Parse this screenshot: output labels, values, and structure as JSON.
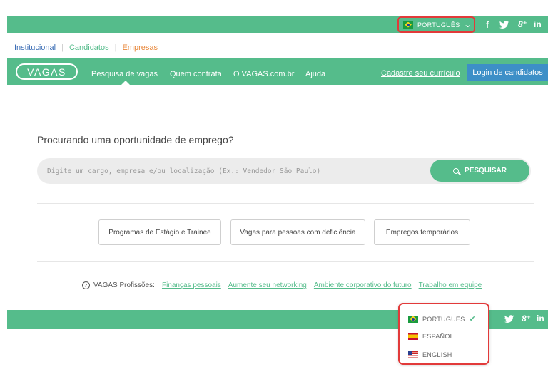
{
  "top_bar": {
    "language_selected": "PORTUGUÊS",
    "chevron": "chevron-down-icon",
    "social": {
      "facebook": "f",
      "twitter": "twitter-bird-icon",
      "google_plus": "8⁺",
      "linkedin": "in"
    }
  },
  "sub_nav": {
    "items": [
      {
        "label": "Institucional"
      },
      {
        "label": "Candidatos"
      },
      {
        "label": "Empresas"
      }
    ]
  },
  "main_nav": {
    "logo": "VAGAS",
    "links": [
      {
        "label": "Pesquisa de vagas"
      },
      {
        "label": "Quem contrata"
      },
      {
        "label": "O VAGAS.com.br"
      },
      {
        "label": "Ajuda"
      }
    ],
    "cadastre": "Cadastre seu currículo",
    "login": "Login de candidatos"
  },
  "search": {
    "heading": "Procurando uma oportunidade de emprego?",
    "placeholder": "Digite um cargo, empresa e/ou localização (Ex.: Vendedor São Paulo)",
    "button": "PESQUISAR"
  },
  "quick_buttons": [
    {
      "label": "Programas de Estágio e Trainee"
    },
    {
      "label": "Vagas para pessoas com deficiência"
    },
    {
      "label": "Empregos temporários"
    }
  ],
  "profissoes": {
    "label": "VAGAS Profissões:",
    "links": [
      {
        "label": "Finanças pessoais"
      },
      {
        "label": "Aumente seu networking"
      },
      {
        "label": "Ambiente corporativo do futuro"
      },
      {
        "label": "Trabalho em equipe"
      }
    ]
  },
  "language_dropdown": {
    "options": [
      {
        "label": "PORTUGUÊS",
        "selected": true
      },
      {
        "label": "ESPAÑOL",
        "selected": false
      },
      {
        "label": "ENGLISH",
        "selected": false
      }
    ],
    "check": "✔"
  },
  "colors": {
    "brand_green": "#55bc8b",
    "login_blue": "#3d8fc7",
    "highlight_red": "#e23a3a",
    "empresas_orange": "#e8873a"
  }
}
